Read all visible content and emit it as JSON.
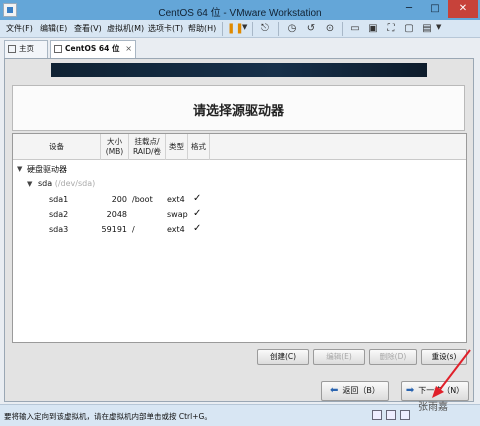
{
  "window": {
    "title": "CentOS 64 位 - VMware Workstation",
    "min": "─",
    "max": "□",
    "close": "✕"
  },
  "menu": [
    "文件(F)",
    "编辑(E)",
    "查看(V)",
    "虚拟机(M)",
    "选项卡(T)",
    "帮助(H)"
  ],
  "tabs": {
    "home": "主页",
    "vm": "CentOS 64 位",
    "close": "×"
  },
  "installer": {
    "heading": "请选择源驱动器",
    "columns": {
      "device": "设备",
      "size": "大小\n(MB)",
      "mount": "挂载点/\nRAID/卷",
      "type": "类型",
      "format": "格式"
    },
    "tree": {
      "group": "硬盘驱动器",
      "disk": "sda",
      "disk_path": "(/dev/sda)",
      "partitions": [
        {
          "name": "sda1",
          "size": "200",
          "mount": "/boot",
          "type": "ext4",
          "format": "✓"
        },
        {
          "name": "sda2",
          "size": "2048",
          "mount": "",
          "type": "swap",
          "format": "✓"
        },
        {
          "name": "sda3",
          "size": "59191",
          "mount": "/",
          "type": "ext4",
          "format": "✓"
        }
      ]
    },
    "buttons": {
      "create": "创建(C)",
      "edit": "编辑(E)",
      "delete": "删除(D)",
      "reset": "重设(s)",
      "back": "返回（B）",
      "next": "下一步（N）"
    }
  },
  "statusbar": {
    "message": "要将输入定向到该虚拟机，请在虚拟机内部单击或按 Ctrl+G。"
  },
  "watermark": "张雨嘉",
  "colors": {
    "titlebar": "#64a6d8",
    "arrow": "#e0202a"
  }
}
